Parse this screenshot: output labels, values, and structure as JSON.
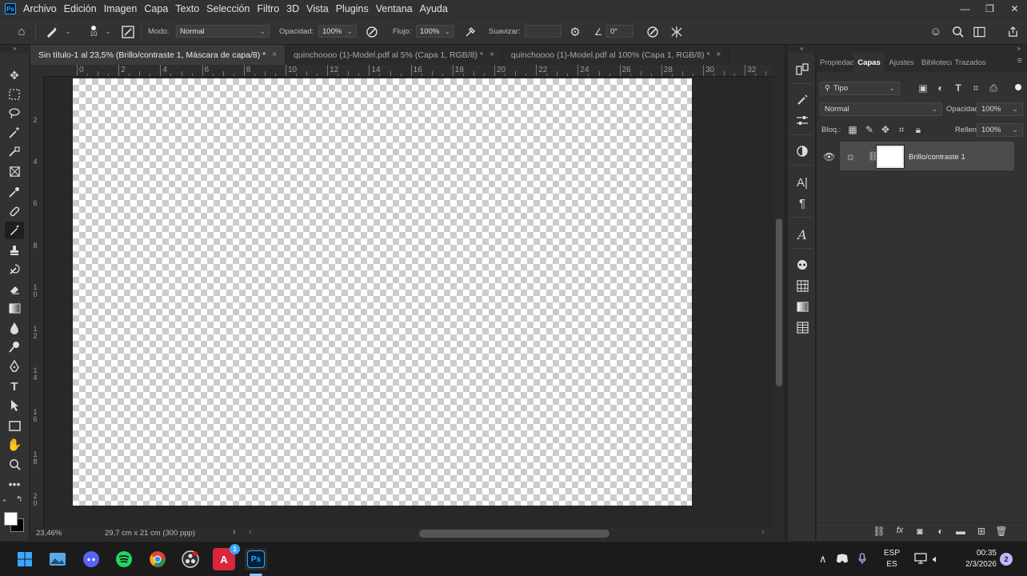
{
  "app": {
    "logo_text": "Ps"
  },
  "menu": [
    "Archivo",
    "Edición",
    "Imagen",
    "Capa",
    "Texto",
    "Selección",
    "Filtro",
    "3D",
    "Vista",
    "Plugins",
    "Ventana",
    "Ayuda"
  ],
  "window_controls": {
    "minimize": "—",
    "restore": "❐",
    "close": "✕"
  },
  "options_bar": {
    "brush_size": "10",
    "mode_label": "Modo:",
    "mode_value": "Normal",
    "opacity_label": "Opacidad:",
    "opacity_value": "100%",
    "flow_label": "Flujo:",
    "flow_value": "100%",
    "smoothing_label": "Suavizar:",
    "smoothing_value": "",
    "angle_value": "0°"
  },
  "tabs": [
    {
      "title": "Sin título-1 al 23,5% (Brillo/contraste 1, Máscara de capa/8) *",
      "active": true
    },
    {
      "title": "quinchoooo (1)-Model.pdf al 5% (Capa 1, RGB/8) *",
      "active": false
    },
    {
      "title": "quinchoooo (1)-Model.pdf al 100% (Capa 1, RGB/8) *",
      "active": false
    }
  ],
  "tab_close": "×",
  "ruler": {
    "horizontal": [
      "0",
      "2",
      "4",
      "6",
      "8",
      "10",
      "12",
      "14",
      "16",
      "18",
      "20",
      "22",
      "24",
      "26",
      "28",
      "30",
      "32"
    ],
    "vertical": [
      "2",
      "4",
      "6",
      "8",
      "1\n0",
      "1\n2",
      "1\n4",
      "1\n6",
      "1\n8",
      "2\n0"
    ]
  },
  "status": {
    "zoom": "23,46%",
    "doc_size": "29,7 cm x 21 cm (300 ppp)",
    "arrow": "›"
  },
  "panel": {
    "tabs": [
      "Propiedades",
      "Capas",
      "Ajustes",
      "Bibliotecas",
      "Trazados"
    ],
    "active_tab": "Capas",
    "filter_label": "Tipo",
    "blend_mode": "Normal",
    "opacity_label": "Opacidad:",
    "opacity_value": "100%",
    "lock_label": "Bloq.:",
    "fill_label": "Relleno:",
    "fill_value": "100%",
    "layer_name": "Brillo/contraste 1"
  },
  "taskbar": {
    "lang_top": "ESP",
    "lang_bottom": "ES",
    "time": "00:35",
    "date": "2/3/2026",
    "notification_count": "2",
    "acrobat_badge": "1",
    "ps_label": "Ps"
  },
  "colors": {
    "ps_blue": "#31a8ff",
    "panel_bg": "#323232",
    "canvas_check": "#cccccc",
    "spotify_green": "#1ed760",
    "discord_blurple": "#5865f2"
  }
}
